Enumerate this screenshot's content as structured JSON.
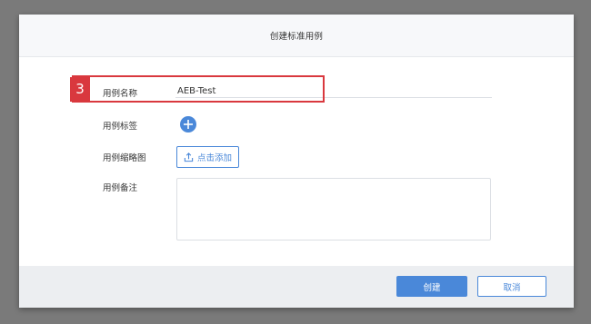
{
  "dialog": {
    "title": "创建标准用例"
  },
  "annotation": {
    "step_number": "3",
    "color": "#d9383e"
  },
  "form": {
    "name_label": "用例名称",
    "name_value": "AEB-Test",
    "tags_label": "用例标签",
    "thumbnail_label": "用例缩略图",
    "upload_label": "点击添加",
    "remark_label": "用例备注",
    "remark_value": ""
  },
  "footer": {
    "create_label": "创建",
    "cancel_label": "取消"
  },
  "colors": {
    "accent": "#4a88d9",
    "overlay": "#7a7a7a"
  },
  "icons": {
    "add_tag": "plus-icon",
    "upload": "upload-icon"
  }
}
